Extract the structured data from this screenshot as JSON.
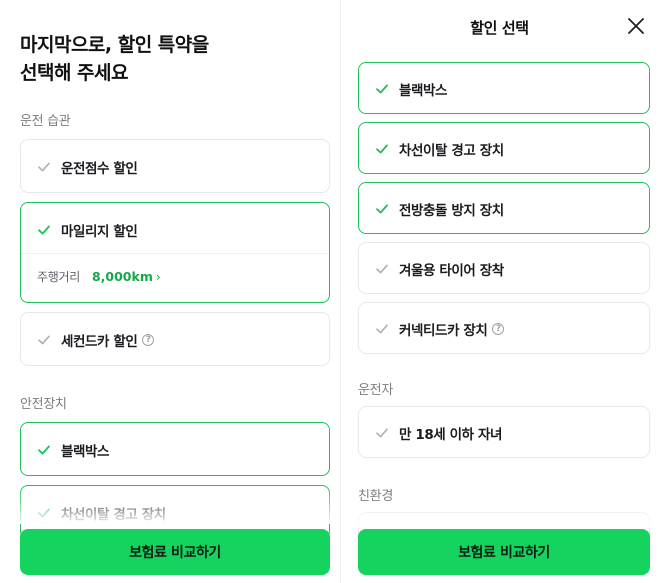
{
  "left": {
    "title_line1": "마지막으로, 할인 특약을",
    "title_line2": "선택해 주세요",
    "sections": {
      "driving_habits": "운전 습관",
      "safety_devices": "안전장치"
    },
    "items": {
      "safe_score": {
        "label": "운전점수 할인",
        "selected": false
      },
      "mileage": {
        "label": "마일리지 할인",
        "selected": true,
        "detail_label": "주행거리",
        "detail_value": "8,000km",
        "detail_chevron": "›"
      },
      "second_car": {
        "label": "세컨드카 할인",
        "selected": false,
        "help": "?"
      },
      "blackbox": {
        "label": "블랙박스",
        "selected": true
      },
      "lane_warning": {
        "label": "차선이탈 경고 장치",
        "selected": true
      }
    },
    "cta_label": "보험료 비교하기"
  },
  "right": {
    "modal_title": "할인 선택",
    "close_icon": "×",
    "sections": {
      "driver": "운전자",
      "eco": "친환경"
    },
    "items": {
      "blackbox": {
        "label": "블랙박스",
        "selected": true
      },
      "lane_warning": {
        "label": "차선이탈 경고 장치",
        "selected": true
      },
      "collision": {
        "label": "전방충돌 방지 장치",
        "selected": true
      },
      "winter_tire": {
        "label": "겨울용 타이어 장착",
        "selected": false
      },
      "connected_car": {
        "label": "커넥티드카 장치",
        "selected": false,
        "help": "?"
      },
      "child": {
        "label": "만 18세 이하 자녀",
        "selected": false
      }
    },
    "cta_label": "보험료 비교하기"
  },
  "colors": {
    "accent": "#14d35e",
    "check_selected": "#1ec15a",
    "check_unselected": "#a9adb2",
    "muted_text": "#7b7f84"
  }
}
